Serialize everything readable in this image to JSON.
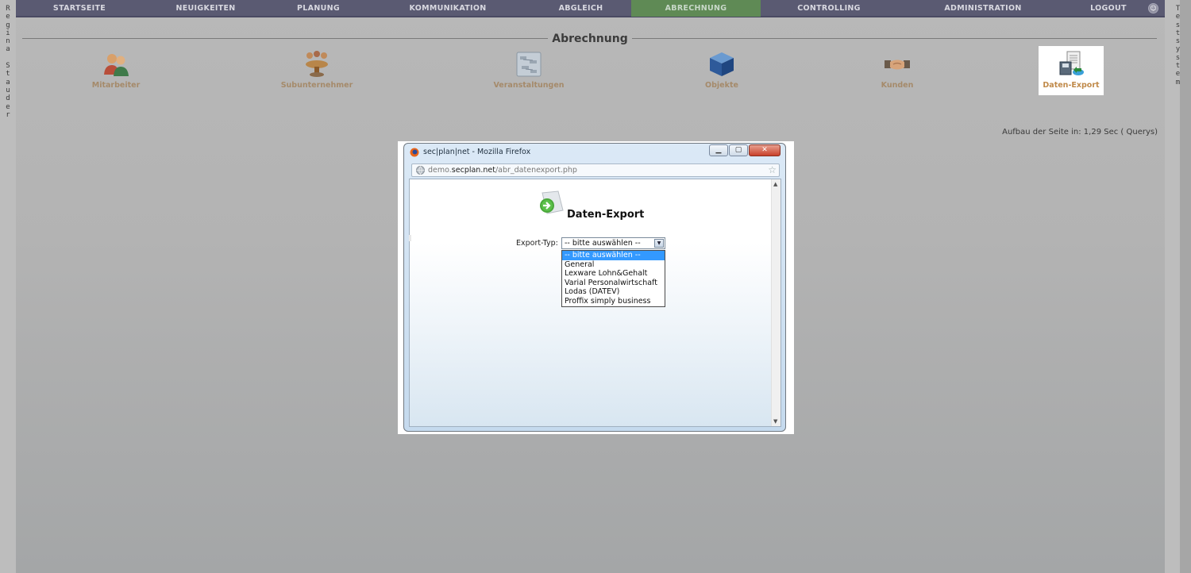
{
  "side_left": {
    "letters": [
      "R",
      "e",
      "g",
      "i",
      "n",
      "a",
      " ",
      "S",
      "t",
      "a",
      "u",
      "d",
      "e",
      "r"
    ]
  },
  "side_right": {
    "letters": [
      "T",
      "e",
      "s",
      "t",
      "s",
      "y",
      "s",
      "t",
      "e",
      "m"
    ]
  },
  "nav": {
    "items": [
      {
        "label": "STARTSEITE",
        "active": false
      },
      {
        "label": "NEUIGKEITEN",
        "active": false
      },
      {
        "label": "PLANUNG",
        "active": false
      },
      {
        "label": "KOMMUNIKATION",
        "active": false
      },
      {
        "label": "ABGLEICH",
        "active": false
      },
      {
        "label": "ABRECHNUNG",
        "active": true
      },
      {
        "label": "CONTROLLING",
        "active": false
      },
      {
        "label": "ADMINISTRATION",
        "active": false
      },
      {
        "label": "LOGOUT",
        "active": false
      }
    ]
  },
  "page": {
    "title": "Abrechnung",
    "perf": "Aufbau der Seite in: 1,29 Sec ( Querys)"
  },
  "modules": [
    {
      "label": "Mitarbeiter",
      "icon": "people-icon"
    },
    {
      "label": "Subunternehmer",
      "icon": "group-table-icon"
    },
    {
      "label": "Veranstaltungen",
      "icon": "event-board-icon"
    },
    {
      "label": "Objekte",
      "icon": "cube-icon"
    },
    {
      "label": "Kunden",
      "icon": "handshake-icon"
    },
    {
      "label": "Daten-Export",
      "icon": "data-export-icon",
      "selected": true
    }
  ],
  "popup": {
    "window_title": "sec|plan|net - Mozilla Firefox",
    "url_prefix": "demo.",
    "url_domain": "secplan.net",
    "url_path": "/abr_datenexport.php",
    "heading": "Daten-Export",
    "export_label": "Export-Typ:",
    "select_value": "-- bitte auswählen --",
    "options": [
      "-- bitte auswählen --",
      "General",
      "Lexware Lohn&Gehalt",
      "Varial Personalwirtschaft",
      "Lodas (DATEV)",
      "Proffix simply business"
    ]
  },
  "colors": {
    "nav_bg": "#5a5a72",
    "nav_active": "#5f8a55",
    "module_label": "#a58a6a",
    "select_highlight": "#3399ff"
  }
}
